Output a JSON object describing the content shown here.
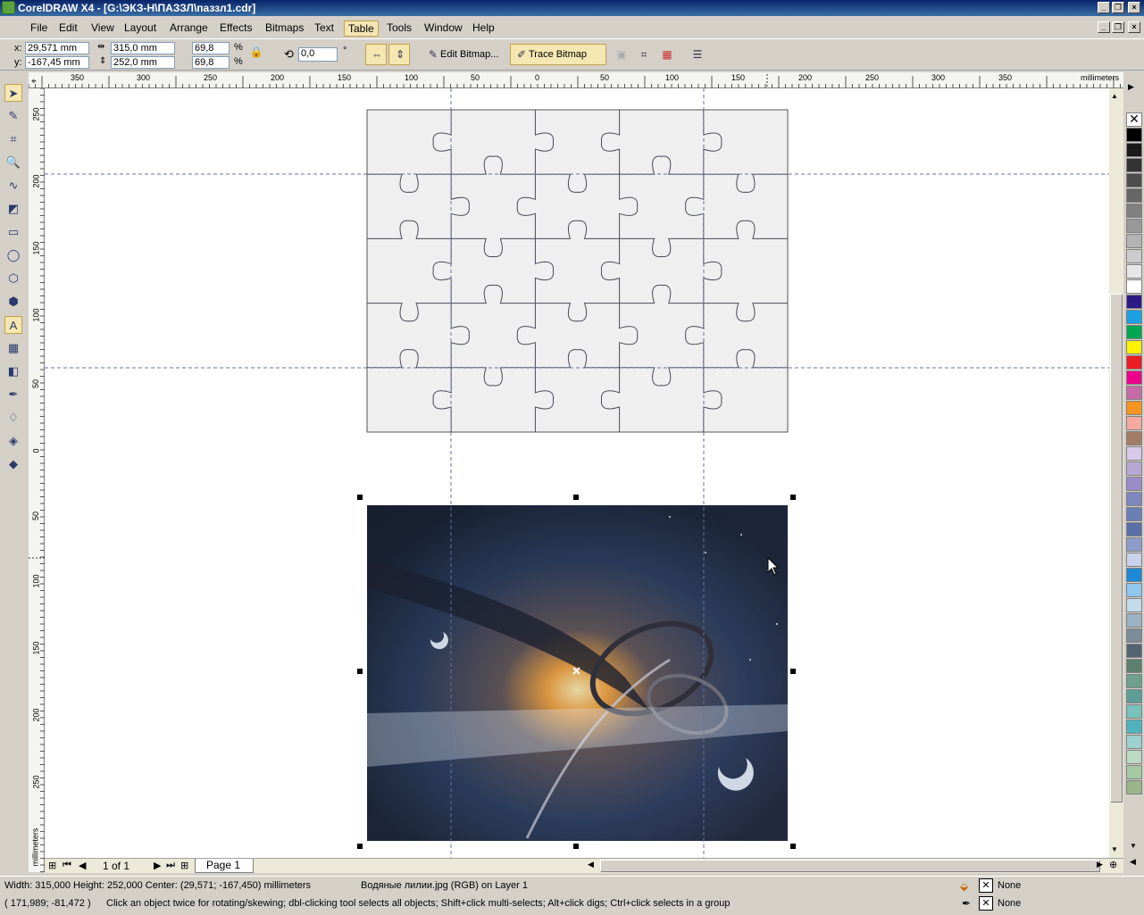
{
  "window": {
    "title": "CorelDRAW X4 - [G:\\ЭКЗ-Н\\ПАЗЗЛ\\паззл1.cdr]"
  },
  "menu": [
    "File",
    "Edit",
    "View",
    "Layout",
    "Arrange",
    "Effects",
    "Bitmaps",
    "Text",
    "Table",
    "Tools",
    "Window",
    "Help"
  ],
  "menu_active": "Table",
  "propbar": {
    "x_label": "x:",
    "x_value": "29,571 mm",
    "y_label": "y:",
    "y_value": "-167,45 mm",
    "w_value": "315,0 mm",
    "h_value": "252,0 mm",
    "scale_x": "69,8",
    "scale_y": "69,8",
    "pct": "%",
    "rotation": "0,0",
    "deg": "°",
    "edit_bitmap": "Edit Bitmap...",
    "trace_bitmap": "Trace Bitmap"
  },
  "hruler": {
    "labels": [
      "350",
      "300",
      "250",
      "200",
      "150",
      "100",
      "50",
      "0",
      "50",
      "100",
      "150",
      "200",
      "250",
      "300",
      "350"
    ],
    "unit": "millimeters"
  },
  "vruler": {
    "labels": [
      "250",
      "200",
      "150",
      "100",
      "50",
      "0",
      "50",
      "100",
      "150",
      "200",
      "250"
    ],
    "unit": "millimeters"
  },
  "pagenav": {
    "count": "1 of 1",
    "page_tab": "Page 1"
  },
  "status": {
    "dimensions": "Width: 315,000  Height: 252,000  Center: (29,571; -167,450)  millimeters",
    "object": "Водяные лилии.jpg (RGB) on Layer 1",
    "coords": "( 171,989; -81,472 )",
    "hint": "Click an object twice for rotating/skewing; dbl-clicking tool selects all objects; Shift+click multi-selects; Alt+click digs; Ctrl+click selects in a group",
    "fill": "None",
    "outline": "None"
  },
  "palette_colors": [
    "#000000",
    "#1a1a1a",
    "#333333",
    "#4d4d4d",
    "#666666",
    "#808080",
    "#999999",
    "#b3b3b3",
    "#cccccc",
    "#e6e6e6",
    "#ffffff",
    "#2e1a87",
    "#1ba1e2",
    "#00a651",
    "#fff200",
    "#ed1c24",
    "#ec008c",
    "#c76ba8",
    "#f7941d",
    "#f6a99f",
    "#a37c68",
    "#d9c9e8",
    "#b7a8d3",
    "#9a8cc8",
    "#7f86c0",
    "#6a7fb8",
    "#5a6ea8",
    "#8d9bc9",
    "#c9d3ec",
    "#1e8ad6",
    "#8fc7ee",
    "#c3dbe9",
    "#9cb3c4",
    "#7a8c99",
    "#546470",
    "#5d7f6e",
    "#6ca08c",
    "#5e9d95",
    "#78c3bd",
    "#4fb3bf",
    "#9bd1cf",
    "#bcd9c2",
    "#a5c9a2",
    "#9bb68a"
  ],
  "icons": {
    "select": "pick-tool-icon",
    "shape": "shape-tool-icon",
    "crop": "crop-tool-icon",
    "zoom": "zoom-tool-icon"
  }
}
